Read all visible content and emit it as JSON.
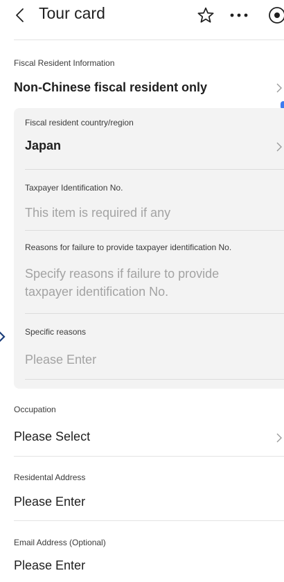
{
  "header": {
    "title": "Tour card"
  },
  "fiscal": {
    "section_label": "Fiscal Resident Information",
    "selected": "Non-Chinese fiscal resident only",
    "country_label": "Fiscal resident country/region",
    "country_value": "Japan",
    "tin_label": "Taxpayer Identification No.",
    "tin_placeholder": "This item is required if any",
    "reason_label": "Reasons for failure to provide taxpayer identification No.",
    "reason_placeholder": "Specify reasons if failure to provide taxpayer identification No.",
    "specific_label": "Specific reasons",
    "specific_placeholder": "Please Enter"
  },
  "occupation": {
    "label": "Occupation",
    "value": "Please Select"
  },
  "address": {
    "label": "Residental Address",
    "value": "Please Enter"
  },
  "email": {
    "label": "Email Address (Optional)",
    "value": "Please Enter"
  },
  "icons": {
    "back": "chevron-left-icon",
    "star": "star-outline-icon",
    "more": "more-horizontal-icon",
    "target": "target-circle-icon"
  },
  "colors": {
    "text": "#1f1f1f",
    "placeholder": "#a3a3a3",
    "card_bg": "#f3f3f3",
    "accent": "#3d7cf0"
  }
}
